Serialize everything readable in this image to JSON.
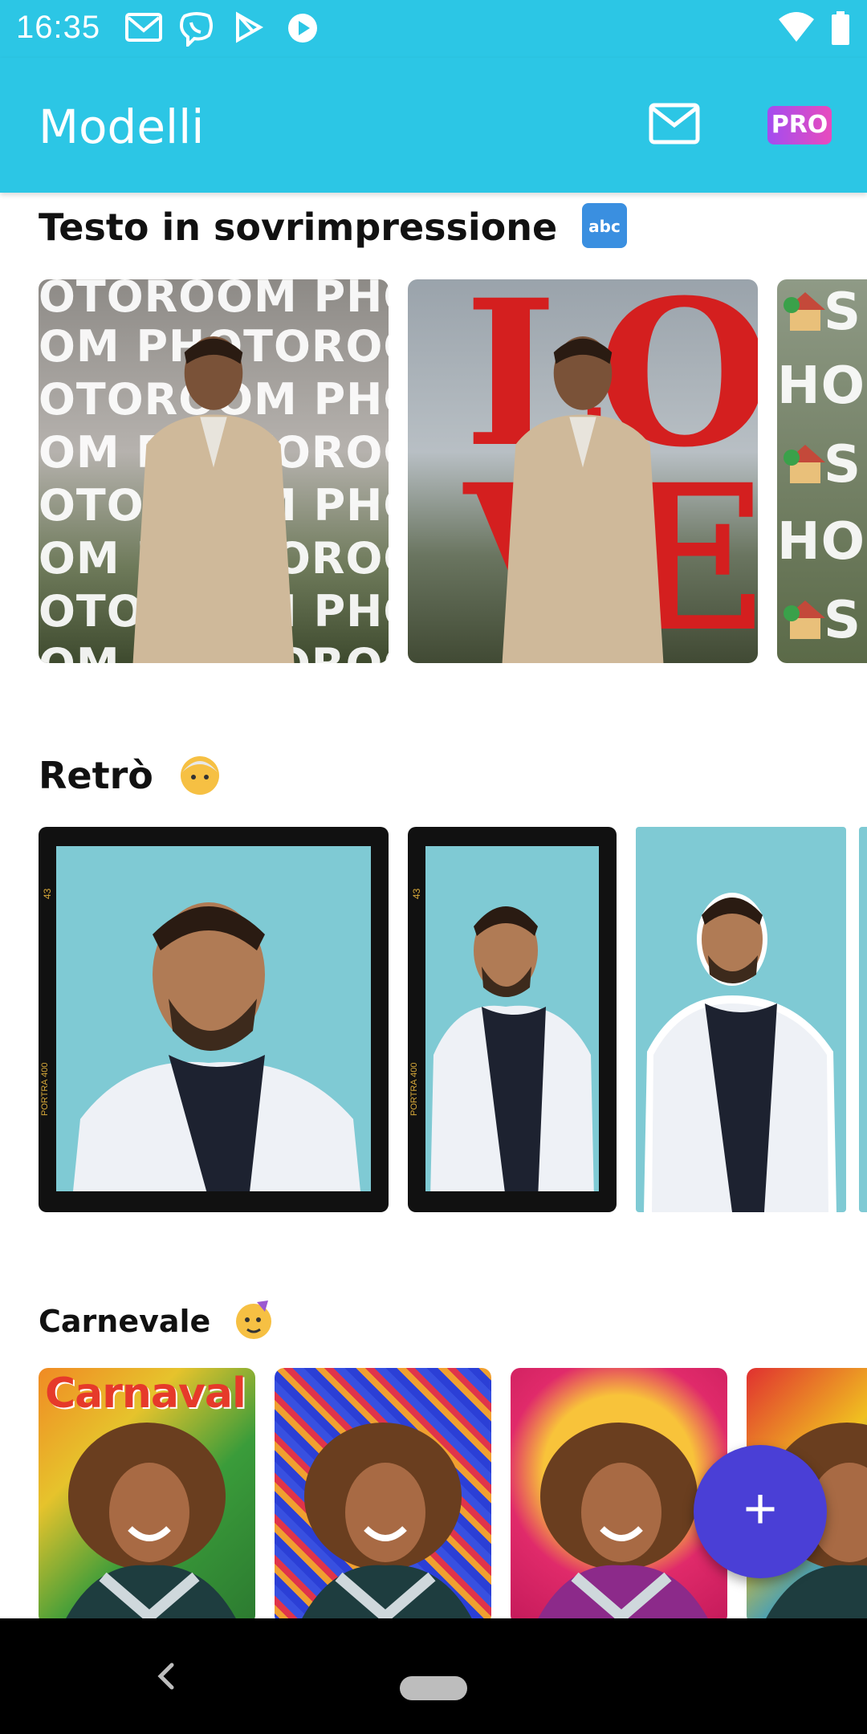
{
  "status_bar": {
    "time": "16:35",
    "icons": [
      "gmail-icon",
      "viber-icon",
      "play-store-icon",
      "play-music-icon",
      "wifi-icon",
      "battery-icon"
    ]
  },
  "app_bar": {
    "title": "Modelli",
    "mail_icon": "mail-icon",
    "pro_label": "PRO"
  },
  "sections": [
    {
      "title": "Testo in sovrimpressione",
      "emoji": "abc-icon",
      "cards": [
        {
          "overlay_text": [
            "OTOROOM PHO",
            "OM PHOTOROO",
            "OTOROOM PHO",
            "OM PHOTOROO",
            "OTOROOM PHO",
            "OM PHOTOROO",
            "OTOROOM PHO",
            "OM PHOTOROO"
          ]
        },
        {
          "overlay_text": [
            "LO",
            "VE"
          ]
        },
        {
          "overlay_text": [
            "S",
            "HOM",
            "S",
            "HOM",
            "S"
          ]
        }
      ]
    },
    {
      "title": "Retrò",
      "emoji": "old-person-icon",
      "cards": [
        {
          "film_label": "PORTRA 400",
          "frame_number": "43"
        },
        {
          "film_label": "PORTRA 400",
          "frame_number": "43"
        },
        {
          "film_label": "",
          "frame_number": ""
        }
      ]
    },
    {
      "title": "Carnevale",
      "emoji": "party-face-icon",
      "cards": [
        {
          "overlay_text": "Carnaval"
        },
        {
          "overlay_text": ""
        },
        {
          "overlay_text": ""
        },
        {
          "overlay_text": ""
        }
      ]
    }
  ],
  "fab": {
    "label": "+"
  },
  "colors": {
    "primary": "#2cc6e5",
    "fab": "#4a3fd6",
    "retro_bg": "#7fcad4"
  }
}
